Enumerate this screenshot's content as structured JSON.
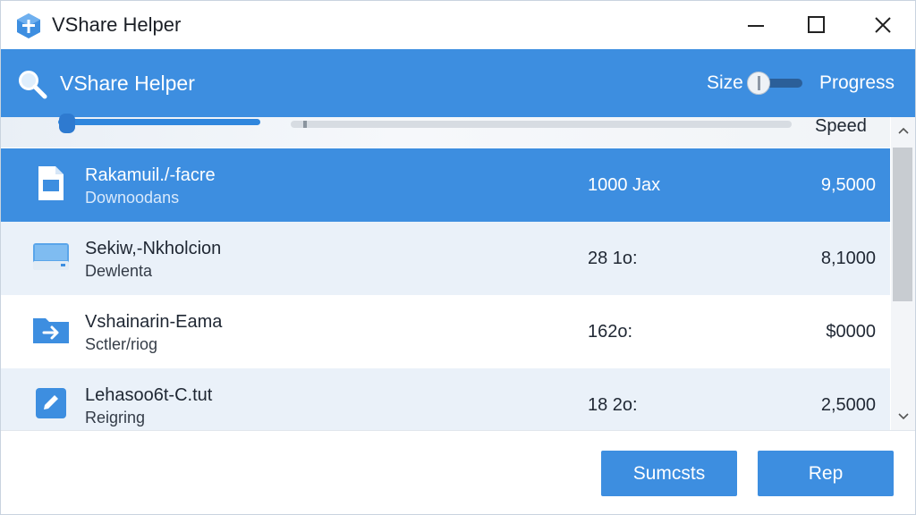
{
  "window": {
    "title": "VShare Helper",
    "icon": "app-logo-icon",
    "controls": [
      "minimize-icon",
      "maximize-icon",
      "close-icon"
    ]
  },
  "header": {
    "title": "VShare Helper",
    "search_icon": "search-icon",
    "size_label": "Size",
    "progress_label": "Progress",
    "accent_color": "#3d8ee0"
  },
  "columns": {
    "speed_label": "Speed"
  },
  "rows": [
    {
      "name": "Rakamuil./-facre",
      "status": "Downoodans",
      "size": "1000 Jax",
      "speed": "9,5000",
      "icon": "document-icon",
      "selected": true
    },
    {
      "name": "Sekiw,-Nkholcion",
      "status": "Dewlenta",
      "size": "28 1o:",
      "speed": "8,1000",
      "icon": "drive-icon",
      "selected": false
    },
    {
      "name": "Vshainarin-Eama",
      "status": "Sctler/riog",
      "size": "162o:",
      "speed": "$0000",
      "icon": "folder-arrow-icon",
      "selected": false
    },
    {
      "name": "Lehasoo6t-C.tut",
      "status": "Reigring",
      "size": "18 2o:",
      "speed": "2,5000",
      "icon": "edit-icon",
      "selected": false
    }
  ],
  "footer": {
    "button_primary": "Sumcsts",
    "button_secondary": "Rep"
  }
}
